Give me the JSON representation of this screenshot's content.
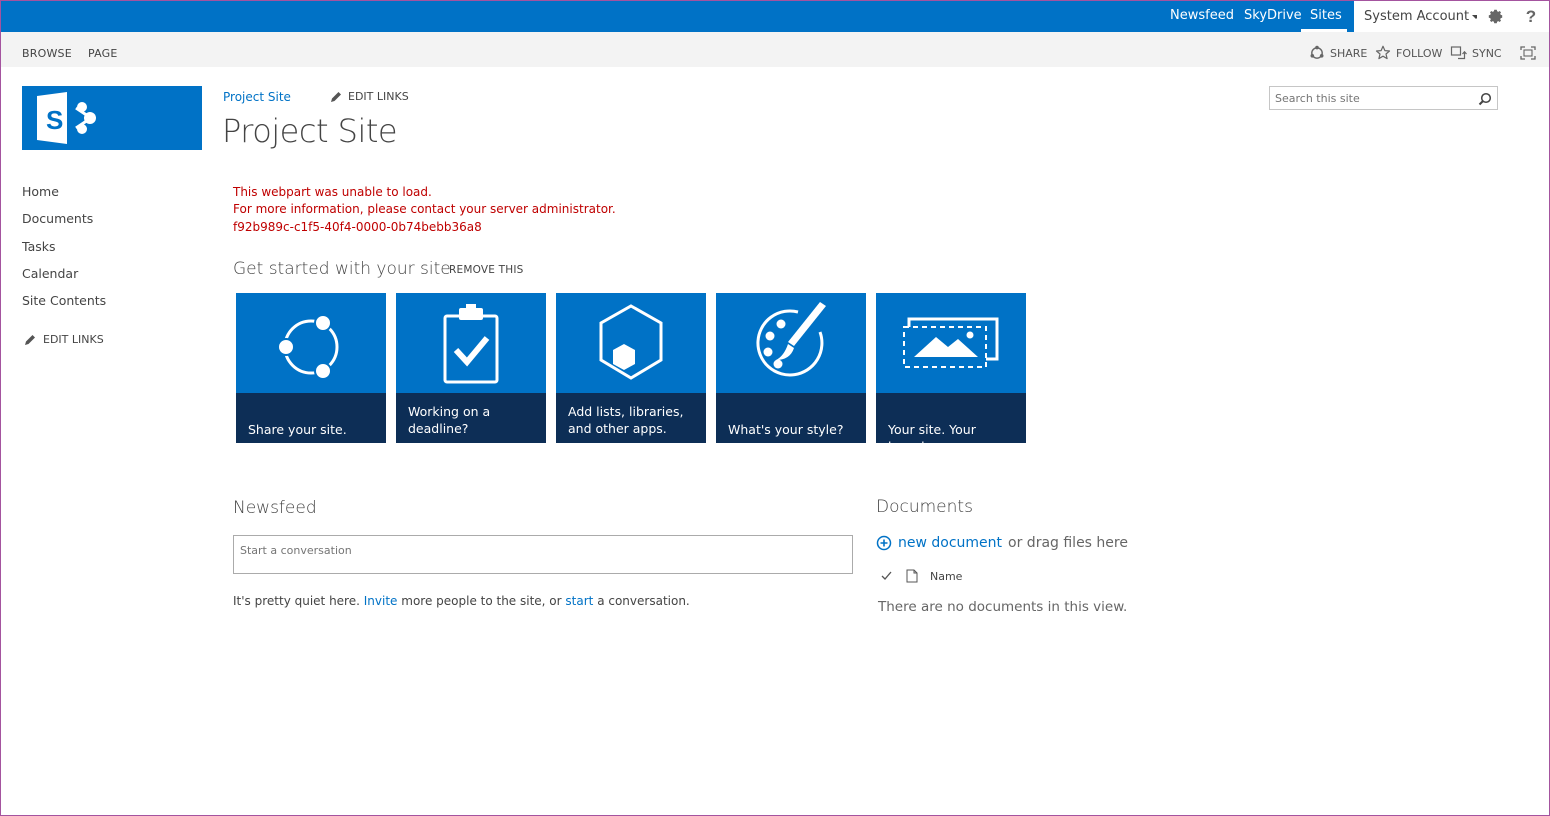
{
  "suitebar": {
    "links": [
      "Newsfeed",
      "SkyDrive",
      "Sites"
    ],
    "account": "System Account",
    "icons": [
      "gear-icon",
      "help-icon"
    ],
    "accent_color": "#0072c6"
  },
  "ribbon": {
    "tabs": [
      "BROWSE",
      "PAGE"
    ],
    "actions": [
      {
        "label": "SHARE",
        "icon": "share-icon"
      },
      {
        "label": "FOLLOW",
        "icon": "star-icon"
      },
      {
        "label": "SYNC",
        "icon": "sync-icon"
      }
    ],
    "focus_icon": "focus-mode-icon"
  },
  "site": {
    "breadcrumb": "Project Site",
    "edit_links": "EDIT LINKS",
    "title": "Project Site",
    "logo_icon": "sharepoint-logo-icon"
  },
  "search": {
    "placeholder": "Search this site"
  },
  "leftnav": {
    "items": [
      "Home",
      "Documents",
      "Tasks",
      "Calendar",
      "Site Contents"
    ],
    "edit_links": "EDIT LINKS"
  },
  "error": {
    "line1": "This webpart was unable to load.",
    "line2": "For more information, please contact your server administrator.",
    "code": "f92b989c-c1f5-40f4-0000-0b74bebb36a8",
    "color": "#bf0000"
  },
  "get_started": {
    "title": "Get started with your site",
    "remove": "REMOVE THIS",
    "tiles": [
      {
        "label": "Share your site.",
        "icon": "share-network-icon"
      },
      {
        "label": "Working on a deadline?",
        "icon": "clipboard-check-icon"
      },
      {
        "label": "Add lists, libraries, and other apps.",
        "icon": "hexagon-apps-icon"
      },
      {
        "label": "What's your style?",
        "icon": "palette-brush-icon"
      },
      {
        "label": "Your site. Your brand.",
        "icon": "image-frame-icon"
      }
    ]
  },
  "newsfeed": {
    "title": "Newsfeed",
    "placeholder": "Start a conversation",
    "quiet_pre": "It's pretty quiet here.",
    "invite": "Invite",
    "quiet_mid": "more people to the site, or",
    "start": "start",
    "quiet_post": "a conversation."
  },
  "documents": {
    "title": "Documents",
    "new_document": "new document",
    "drag_text": "or drag files here",
    "column_name": "Name",
    "empty": "There are no documents in this view."
  }
}
